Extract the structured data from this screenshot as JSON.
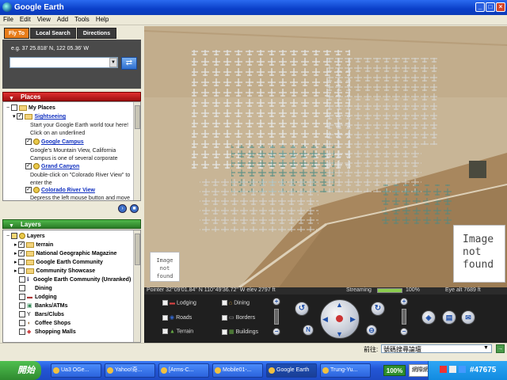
{
  "window": {
    "title": "Google Earth",
    "controls": [
      "_",
      "□",
      "×"
    ]
  },
  "menu": [
    "File",
    "Edit",
    "View",
    "Add",
    "Tools",
    "Help"
  ],
  "search": {
    "tabs": [
      "Fly To",
      "Local Search",
      "Directions"
    ],
    "hint": "e.g. 37 25.818' N, 122 05.36' W",
    "value": "",
    "go": "⇄"
  },
  "places": {
    "header": "Places",
    "rows": [
      {
        "label": "My Places",
        "type": "folder",
        "checked": false,
        "expander": "−"
      },
      {
        "label": "Sightseeing",
        "type": "link",
        "checked": true,
        "expander": "▾"
      },
      {
        "text": "Start your Google Earth world tour here!"
      },
      {
        "text": "Click on an underlined"
      },
      {
        "label": "Google Campus",
        "type": "placemark",
        "checked": true
      },
      {
        "text": "Google's Mountain View, California"
      },
      {
        "text": "Campus is one of several corporate"
      },
      {
        "label": "Grand Canyon",
        "type": "placemark",
        "checked": true
      },
      {
        "text": "Double-click on \"Colorado River View\" to"
      },
      {
        "text": "enter the"
      },
      {
        "label": "Colorado River View",
        "type": "placemark",
        "checked": true
      },
      {
        "text": "Depress the left mouse button and move"
      }
    ]
  },
  "layers": {
    "header": "Layers",
    "rows": [
      {
        "label": "Layers",
        "checked": "partial",
        "expander": "−"
      },
      {
        "label": "terrain",
        "checked": true,
        "expander": "▸"
      },
      {
        "label": "National Geographic Magazine",
        "checked": true,
        "expander": "▸"
      },
      {
        "label": "Google Earth Community",
        "checked": false,
        "expander": "▸"
      },
      {
        "label": "Community Showcase",
        "checked": false,
        "expander": "▸"
      },
      {
        "label": "Google Earth Community (Unranked)",
        "checked": false
      },
      {
        "label": "Dining",
        "checked": false
      },
      {
        "label": "Lodging",
        "checked": false
      },
      {
        "label": "Banks/ATMs",
        "checked": false
      },
      {
        "label": "Bars/Clubs",
        "checked": false
      },
      {
        "label": "Coffee Shops",
        "checked": false
      },
      {
        "label": "Shopping Malls",
        "checked": false
      }
    ]
  },
  "status": {
    "pointer": "Pointer 32°09'01.84\" N  110°49'36.72\" W  elev 2797 ft",
    "streaming": "Streaming",
    "percent": "100%",
    "eye": "Eye alt   7689 ft",
    "stream_progress": 1.0
  },
  "hud_toggles": [
    {
      "label": "Lodging",
      "checked": false
    },
    {
      "label": "Dining",
      "checked": false
    },
    {
      "label": "Roads",
      "checked": false
    },
    {
      "label": "Borders",
      "checked": false
    },
    {
      "label": "Terrain",
      "checked": true
    },
    {
      "label": "Buildings",
      "checked": false
    }
  ],
  "map": {
    "placeholder_small": [
      "Image",
      "not",
      "found"
    ],
    "placeholder_large": [
      "Image",
      "not",
      "found"
    ]
  },
  "bottom": {
    "label": "前往:",
    "value": "號碼搜尋論壇"
  },
  "taskbar": {
    "start": "開始",
    "items": [
      "Ua3 OGe...",
      "Yahoo!奇...",
      "[Arms-C...",
      "Mobile01-...",
      "Google Earth",
      "Trung-Yu..."
    ],
    "active": 4,
    "tray_percent": "100%",
    "tray_net": "網際網路",
    "tray_id": "#47675"
  }
}
